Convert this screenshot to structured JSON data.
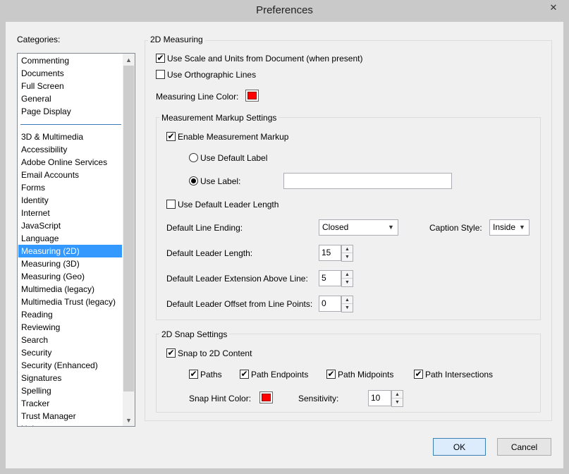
{
  "window": {
    "title": "Preferences",
    "close_glyph": "✕"
  },
  "categories": {
    "label": "Categories:",
    "group1": [
      "Commenting",
      "Documents",
      "Full Screen",
      "General",
      "Page Display"
    ],
    "group2": [
      "3D & Multimedia",
      "Accessibility",
      "Adobe Online Services",
      "Email Accounts",
      "Forms",
      "Identity",
      "Internet",
      "JavaScript",
      "Language",
      "Measuring (2D)",
      "Measuring (3D)",
      "Measuring (Geo)",
      "Multimedia (legacy)",
      "Multimedia Trust (legacy)",
      "Reading",
      "Reviewing",
      "Search",
      "Security",
      "Security (Enhanced)",
      "Signatures",
      "Spelling",
      "Tracker",
      "Trust Manager",
      "Units"
    ],
    "selected": "Measuring (2D)"
  },
  "measuring": {
    "group_title": "2D Measuring",
    "use_scale_label": "Use Scale and Units from Document (when present)",
    "use_scale_checked": true,
    "use_ortho_label": "Use Orthographic Lines",
    "use_ortho_checked": false,
    "line_color_label": "Measuring Line Color:",
    "line_color": "#ff0000"
  },
  "markup": {
    "group_title": "Measurement Markup Settings",
    "enable_label": "Enable Measurement Markup",
    "enable_checked": true,
    "default_label_option": "Use Default Label",
    "use_label_option": "Use Label:",
    "use_label_selected": true,
    "label_value": "",
    "leader_length_cb_label": "Use Default Leader Length",
    "leader_length_cb_checked": false,
    "line_ending_label": "Default Line Ending:",
    "line_ending_value": "Closed",
    "caption_style_label": "Caption Style:",
    "caption_style_value": "Inside",
    "leader_length_label": "Default Leader Length:",
    "leader_length_value": "15",
    "leader_ext_label": "Default Leader Extension Above Line:",
    "leader_ext_value": "5",
    "leader_offset_label": "Default Leader Offset from Line Points:",
    "leader_offset_value": "0"
  },
  "snap": {
    "group_title": "2D Snap Settings",
    "snap_label": "Snap to 2D Content",
    "snap_checked": true,
    "paths_label": "Paths",
    "endpoints_label": "Path Endpoints",
    "midpoints_label": "Path Midpoints",
    "intersections_label": "Path Intersections",
    "hint_color_label": "Snap Hint Color:",
    "hint_color": "#ff0000",
    "sensitivity_label": "Sensitivity:",
    "sensitivity_value": "10"
  },
  "buttons": {
    "ok": "OK",
    "cancel": "Cancel"
  },
  "glyphs": {
    "check": "✔",
    "up": "▲",
    "down": "▼"
  }
}
